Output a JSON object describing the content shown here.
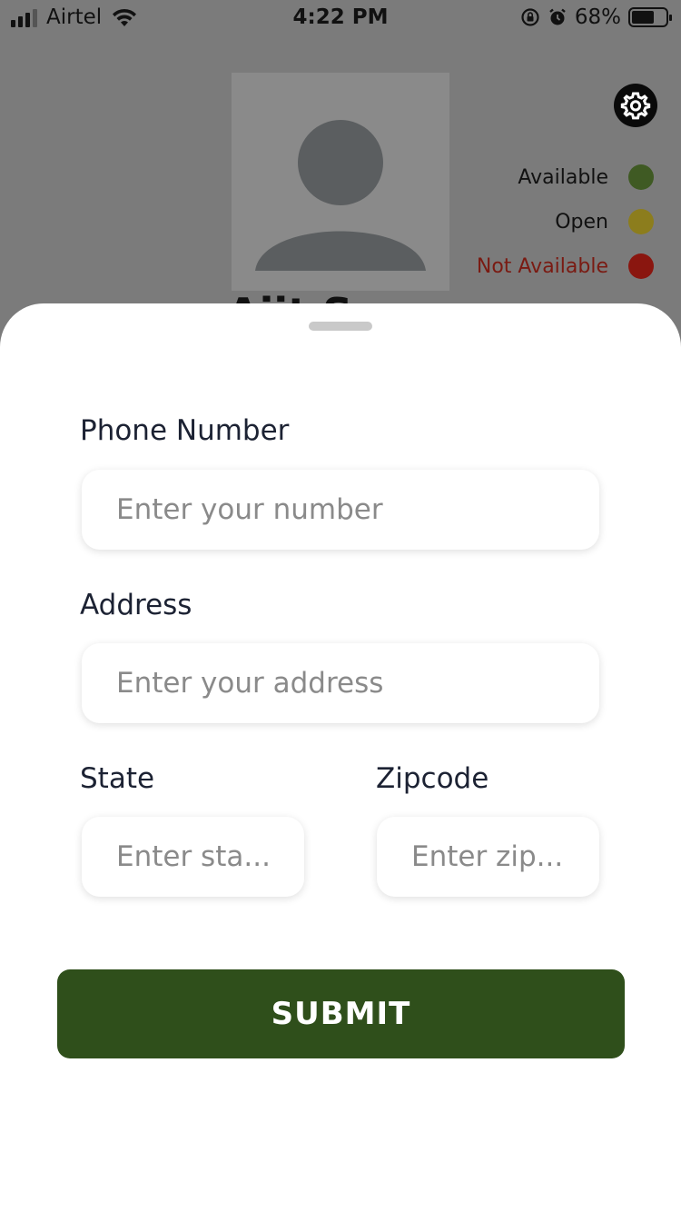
{
  "status_bar": {
    "carrier": "Airtel",
    "time": "4:22 PM",
    "battery_percent": "68%",
    "battery_level": 0.68
  },
  "profile": {
    "avatar_icon": "person-placeholder-icon",
    "settings_icon": "gear-icon",
    "name_partial": "Ajit S"
  },
  "availability_legend": [
    {
      "label": "Available",
      "color": "#3f5a23",
      "label_color": "#111111"
    },
    {
      "label": "Open",
      "color": "#8c7d1d",
      "label_color": "#111111"
    },
    {
      "label": "Not Available",
      "color": "#8a160f",
      "label_color": "#7a1a12"
    }
  ],
  "form": {
    "phone": {
      "label": "Phone Number",
      "placeholder": "Enter your number",
      "value": ""
    },
    "address": {
      "label": "Address",
      "placeholder": "Enter your address",
      "value": ""
    },
    "state": {
      "label": "State",
      "placeholder": "Enter sta...",
      "value": ""
    },
    "zipcode": {
      "label": "Zipcode",
      "placeholder": "Enter zip...",
      "value": ""
    },
    "submit_label": "SUBMIT"
  },
  "colors": {
    "submit_bg": "#2f4f1b",
    "overlay_bg": "#7b7b7b",
    "sheet_bg": "#ffffff"
  }
}
